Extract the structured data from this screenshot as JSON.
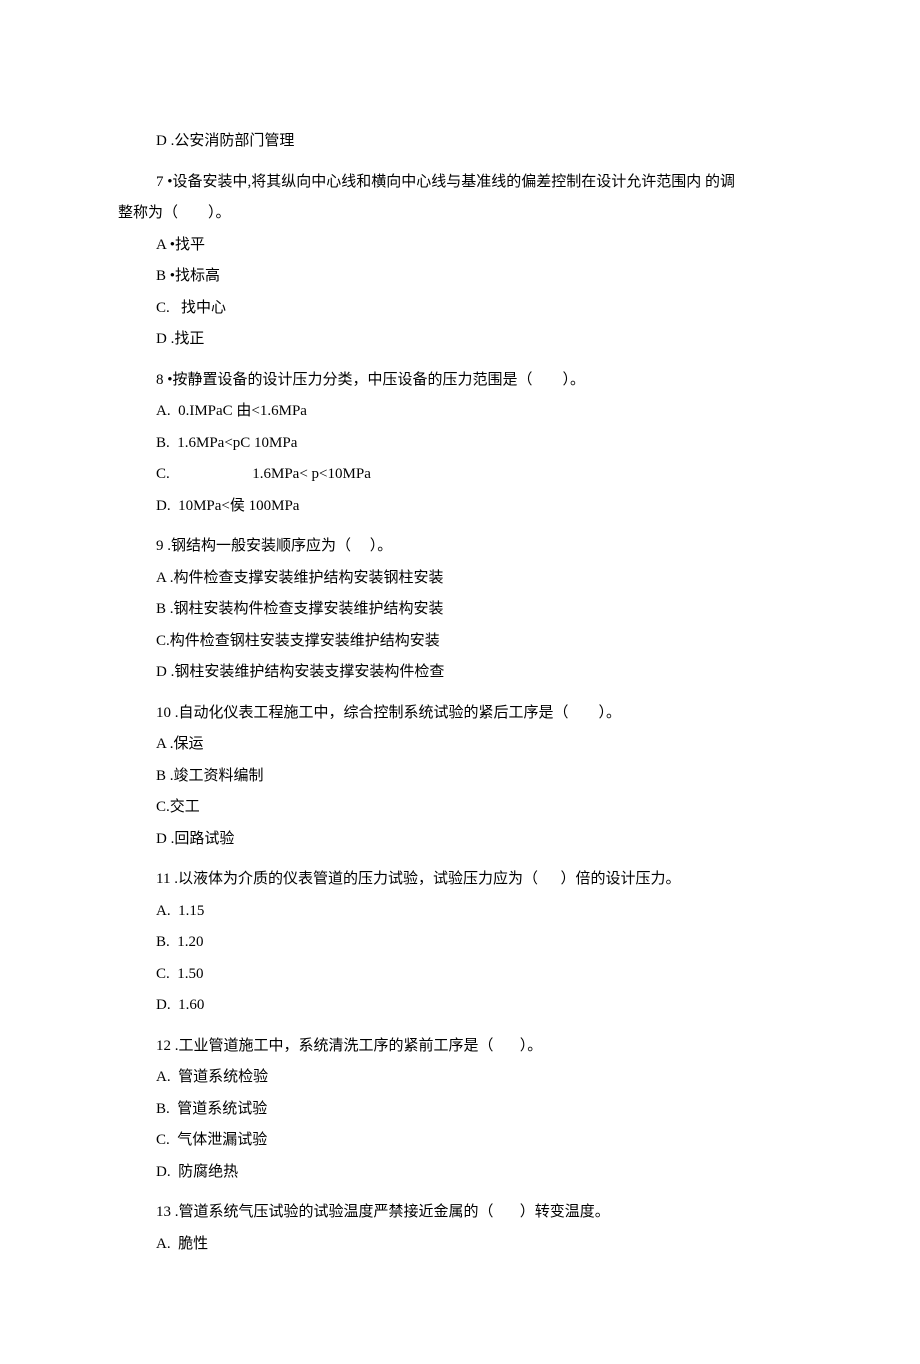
{
  "lines": [
    {
      "cls": "indent-1",
      "text": "D .公安消防部门管理"
    },
    {
      "cls": "gap"
    },
    {
      "cls": "indent-1",
      "text": "7 •设备安装中,将其纵向中心线和横向中心线与基准线的偏差控制在设计允许范围内 的调"
    },
    {
      "cls": "indent-0",
      "text": "整称为（        ）。"
    },
    {
      "cls": "indent-1",
      "text": "A •找平"
    },
    {
      "cls": "indent-1",
      "text": "B •找标高"
    },
    {
      "cls": "indent-1",
      "text": "C.   找中心"
    },
    {
      "cls": "indent-1",
      "text": "D .找正"
    },
    {
      "cls": "gap"
    },
    {
      "cls": "indent-1",
      "text": "8 •按静置设备的设计压力分类，中压设备的压力范围是（        ）。"
    },
    {
      "cls": "indent-1",
      "text": "A.  0.IMPaC 由<1.6MPa"
    },
    {
      "cls": "indent-1",
      "text": "B.  1.6MPa<pC 10MPa"
    },
    {
      "cls": "indent-1",
      "text": "C.                      1.6MPa< p<10MPa"
    },
    {
      "cls": "indent-1",
      "text": "D.  10MPa<侯 100MPa"
    },
    {
      "cls": "gap"
    },
    {
      "cls": "indent-1",
      "text": "9 .钢结构一般安装顺序应为（     ）。"
    },
    {
      "cls": "indent-1",
      "text": "A .构件检查支撑安装维护结构安装钢柱安装"
    },
    {
      "cls": "indent-1",
      "text": "B .钢柱安装构件检查支撑安装维护结构安装"
    },
    {
      "cls": "indent-1",
      "text": "C.构件检查钢柱安装支撑安装维护结构安装"
    },
    {
      "cls": "indent-1",
      "text": "D .钢柱安装维护结构安装支撑安装构件检查"
    },
    {
      "cls": "gap"
    },
    {
      "cls": "indent-1",
      "text": "10 .自动化仪表工程施工中，综合控制系统试验的紧后工序是（        ）。"
    },
    {
      "cls": "indent-1",
      "text": "A .保运"
    },
    {
      "cls": "indent-1",
      "text": "B .竣工资料编制"
    },
    {
      "cls": "indent-1",
      "text": "C.交工"
    },
    {
      "cls": "indent-1",
      "text": "D .回路试验"
    },
    {
      "cls": "gap"
    },
    {
      "cls": "indent-1",
      "text": "11 .以液体为介质的仪表管道的压力试验，试验压力应为（      ）倍的设计压力。"
    },
    {
      "cls": "indent-1",
      "text": "A.  1.15"
    },
    {
      "cls": "indent-1",
      "text": "B.  1.20"
    },
    {
      "cls": "indent-1",
      "text": "C.  1.50"
    },
    {
      "cls": "indent-1",
      "text": "D.  1.60"
    },
    {
      "cls": "gap"
    },
    {
      "cls": "indent-1",
      "text": "12 .工业管道施工中，系统清洗工序的紧前工序是（       ）。"
    },
    {
      "cls": "indent-1",
      "text": "A.  管道系统检验"
    },
    {
      "cls": "indent-1",
      "text": "B.  管道系统试验"
    },
    {
      "cls": "indent-1",
      "text": "C.  气体泄漏试验"
    },
    {
      "cls": "indent-1",
      "text": "D.  防腐绝热"
    },
    {
      "cls": "gap"
    },
    {
      "cls": "indent-1",
      "text": "13 .管道系统气压试验的试验温度严禁接近金属的（       ）转变温度。"
    },
    {
      "cls": "indent-1",
      "text": "A.  脆性"
    }
  ]
}
